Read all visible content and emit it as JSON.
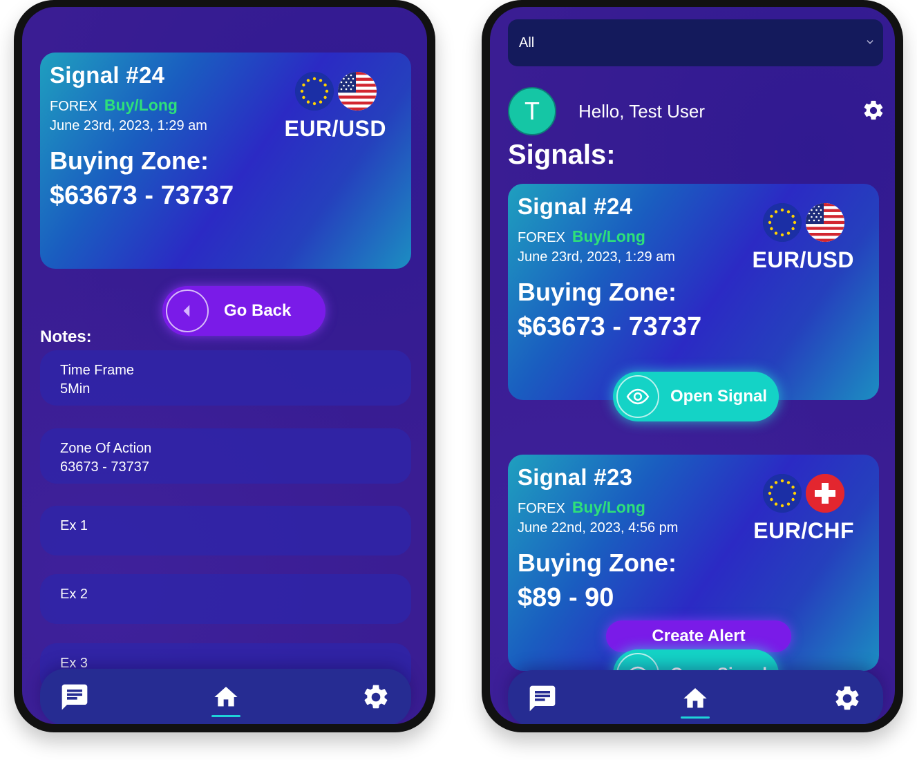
{
  "colors": {
    "background": "#3a1d93",
    "card_gradient_start": "#1fa0bf",
    "card_gradient_mid": "#2b2ac4",
    "direction_green": "#2ee07a",
    "purple_button": "#7a1be8",
    "teal_button": "#14d3c6",
    "nav_bar": "#262c92",
    "nav_active_underline": "#1fd3d8"
  },
  "detail_screen": {
    "signal": {
      "title": "Signal #24",
      "market": "FOREX",
      "direction": "Buy/Long",
      "date": "June  23rd, 2023, 1:29 am",
      "zone_label": "Buying Zone:",
      "zone_value": "$63673 - 73737",
      "pair": "EUR/USD",
      "flags": [
        "eu-flag-icon",
        "us-flag-icon"
      ]
    },
    "go_back_label": "Go Back",
    "go_back_icon": "chevron-left-icon",
    "notes_title": "Notes:",
    "notes": [
      {
        "title": "Time Frame",
        "value": "5Min"
      },
      {
        "title": "Zone Of Action",
        "value": "63673 - 73737"
      },
      {
        "title": "Ex 1",
        "value": ""
      },
      {
        "title": "Ex 2",
        "value": ""
      },
      {
        "title": "Ex 3",
        "value": ""
      }
    ]
  },
  "list_screen": {
    "filter": {
      "selected": "All",
      "icon": "chevron-down-icon"
    },
    "user": {
      "avatar_initial": "T",
      "greeting": "Hello, Test User"
    },
    "settings_icon": "gear-icon",
    "heading": "Signals:",
    "signals": [
      {
        "title": "Signal #24",
        "market": "FOREX",
        "direction": "Buy/Long",
        "date": "June  23rd, 2023, 1:29 am",
        "zone_label": "Buying Zone:",
        "zone_value": "$63673 - 73737",
        "pair": "EUR/USD",
        "flags": [
          "eu-flag-icon",
          "us-flag-icon"
        ],
        "open_label": "Open Signal"
      },
      {
        "title": "Signal #23",
        "market": "FOREX",
        "direction": "Buy/Long",
        "date": "June  22nd, 2023, 4:56 pm",
        "zone_label": "Buying Zone:",
        "zone_value": "$89 - 90",
        "pair": "EUR/CHF",
        "flags": [
          "eu-flag-icon",
          "swiss-flag-icon"
        ],
        "alert_label": "Create Alert",
        "open_label": "Open Signal"
      }
    ]
  },
  "nav": {
    "items": [
      {
        "icon": "chat-icon"
      },
      {
        "icon": "home-icon",
        "active": true
      },
      {
        "icon": "gear-icon"
      }
    ]
  }
}
